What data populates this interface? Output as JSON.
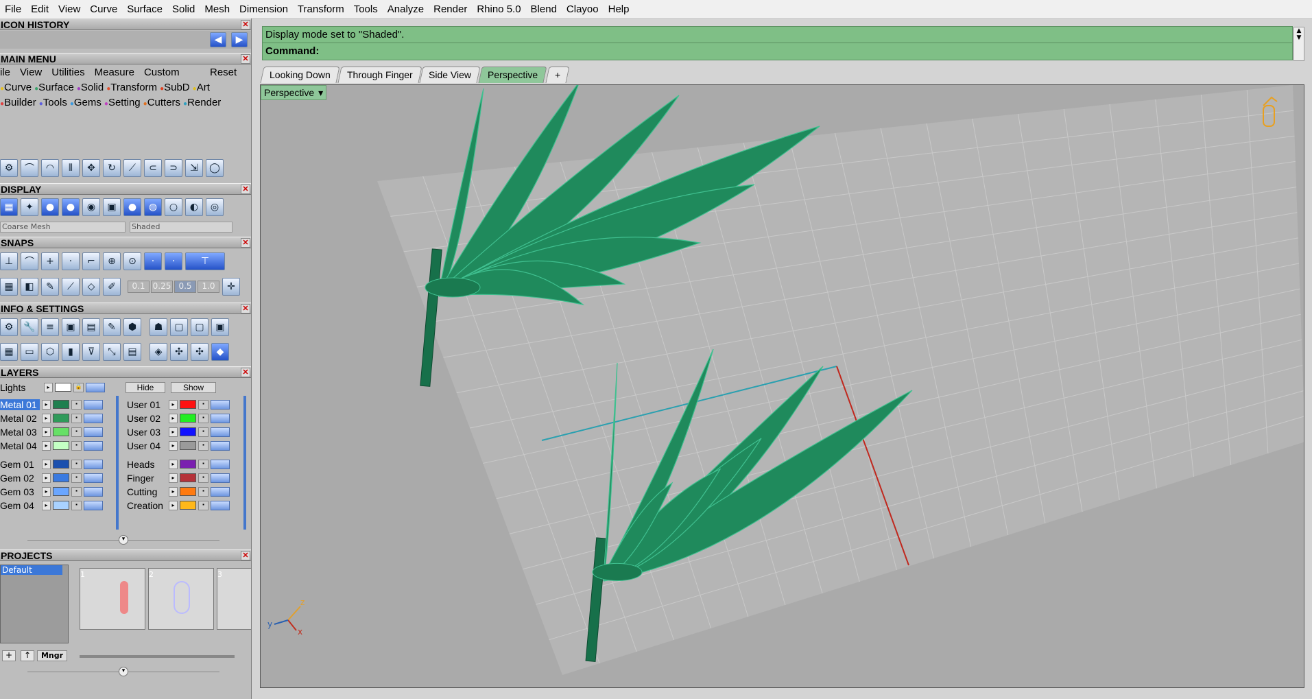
{
  "menubar": {
    "items": [
      "File",
      "Edit",
      "View",
      "Curve",
      "Surface",
      "Solid",
      "Mesh",
      "Dimension",
      "Transform",
      "Tools",
      "Analyze",
      "Render",
      "Rhino 5.0",
      "Blend",
      "Clayoo",
      "Help"
    ]
  },
  "icon_history": {
    "title": "ICON HISTORY"
  },
  "main_menu": {
    "title": "MAIN MENU",
    "tabs": [
      "ile",
      "View",
      "Utilities",
      "Measure",
      "Custom"
    ],
    "reset": "Reset",
    "row1": [
      "Curve",
      "Surface",
      "Solid",
      "Transform",
      "SubD",
      "Art"
    ],
    "row2": [
      "Builder",
      "Tools",
      "Gems",
      "Setting",
      "Cutters",
      "Render"
    ]
  },
  "display": {
    "title": "DISPLAY",
    "mesh_select": "Coarse Mesh",
    "mode_select": "Shaded"
  },
  "snaps": {
    "title": "SNAPS",
    "values": [
      "0.1",
      "0.25",
      "0.5",
      "1.0"
    ]
  },
  "info_settings": {
    "title": "INFO & SETTINGS"
  },
  "layers": {
    "title": "LAYERS",
    "lights": "Lights",
    "hide": "Hide",
    "show": "Show",
    "left": [
      {
        "name": "Metal 01",
        "color": "#1f7f4f"
      },
      {
        "name": "Metal 02",
        "color": "#2f9a5a"
      },
      {
        "name": "Metal 03",
        "color": "#66e066"
      },
      {
        "name": "Metal 04",
        "color": "#c4ffc4"
      },
      {
        "name": "Gem 01",
        "color": "#1a4fae"
      },
      {
        "name": "Gem 02",
        "color": "#3a7ae0"
      },
      {
        "name": "Gem 03",
        "color": "#6aa6ff"
      },
      {
        "name": "Gem 04",
        "color": "#a9d2ff"
      }
    ],
    "right": [
      {
        "name": "User 01",
        "color": "#ff1111"
      },
      {
        "name": "User 02",
        "color": "#22ee22"
      },
      {
        "name": "User 03",
        "color": "#1111ff"
      },
      {
        "name": "User 04",
        "color": "#9a9a9a"
      },
      {
        "name": "Heads",
        "color": "#7a1fb0"
      },
      {
        "name": "Finger",
        "color": "#b5323a"
      },
      {
        "name": "Cutting",
        "color": "#ff7a10"
      },
      {
        "name": "Creation",
        "color": "#ffb81a"
      }
    ]
  },
  "projects": {
    "title": "PROJECTS",
    "list": [
      "Default"
    ],
    "thumbs": [
      "1",
      "2",
      "3"
    ],
    "mngr": "Mngr"
  },
  "command": {
    "status": "Display mode set to \"Shaded\".",
    "label": "Command:"
  },
  "tabs": [
    "Looking Down",
    "Through Finger",
    "Side View",
    "Perspective"
  ],
  "active_tab": "Perspective",
  "viewport": {
    "label": "Perspective",
    "axis_x": "x",
    "axis_y": "y",
    "axis_z": "z"
  },
  "colors": {
    "command_bg": "#7fbf86",
    "active_tab": "#8fc79a",
    "model": "#1f8a5c",
    "grid": "#bdbdbd"
  }
}
